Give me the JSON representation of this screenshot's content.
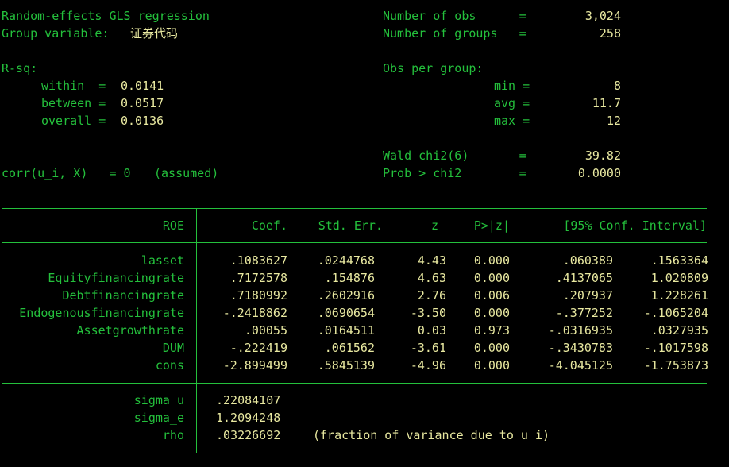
{
  "header": {
    "title": "Random-effects GLS regression",
    "group_label": "Group variable:",
    "group_value": "证券代码",
    "rsq_label": "R-sq:",
    "within_label": "within  =",
    "within_value": "0.0141",
    "between_label": "between =",
    "between_value": "0.0517",
    "overall_label": "overall =",
    "overall_value": "0.0136",
    "corr_label": "corr(u_i, X)   = 0",
    "corr_note": "(assumed)",
    "nobs_label": "Number of obs      =",
    "nobs_value": "3,024",
    "ngroups_label": "Number of groups   =",
    "ngroups_value": "258",
    "obs_per_group_label": "Obs per group:",
    "min_label": "min =",
    "min_value": "8",
    "avg_label": "avg =",
    "avg_value": "11.7",
    "max_label": "max =",
    "max_value": "12",
    "wald_label": "Wald chi2(6)       =",
    "wald_value": "39.82",
    "prob_label": "Prob > chi2        =",
    "prob_value": "0.0000"
  },
  "table": {
    "depvar": "ROE",
    "columns": [
      "Coef.",
      "Std. Err.",
      "z",
      "P>|z|",
      "[95% Conf. Interval]"
    ],
    "rows": [
      {
        "name": "lasset",
        "coef": ".1083627",
        "se": ".0244768",
        "z": "4.43",
        "p": "0.000",
        "lo": ".060389",
        "hi": ".1563364"
      },
      {
        "name": "Equityfinancingrate",
        "coef": ".7172578",
        "se": ".154876",
        "z": "4.63",
        "p": "0.000",
        "lo": ".4137065",
        "hi": "1.020809"
      },
      {
        "name": "Debtfinancingrate",
        "coef": ".7180992",
        "se": ".2602916",
        "z": "2.76",
        "p": "0.006",
        "lo": ".207937",
        "hi": "1.228261"
      },
      {
        "name": "Endogenousfinancingrate",
        "coef": "-.2418862",
        "se": ".0690654",
        "z": "-3.50",
        "p": "0.000",
        "lo": "-.377252",
        "hi": "-.1065204"
      },
      {
        "name": "Assetgrowthrate",
        "coef": ".00055",
        "se": ".0164511",
        "z": "0.03",
        "p": "0.973",
        "lo": "-.0316935",
        "hi": ".0327935"
      },
      {
        "name": "DUM",
        "coef": "-.222419",
        "se": ".061562",
        "z": "-3.61",
        "p": "0.000",
        "lo": "-.3430783",
        "hi": "-.1017598"
      },
      {
        "name": "_cons",
        "coef": "-2.899499",
        "se": ".5845139",
        "z": "-4.96",
        "p": "0.000",
        "lo": "-4.045125",
        "hi": "-1.753873"
      }
    ],
    "sigma_u_label": "sigma_u",
    "sigma_u": ".22084107",
    "sigma_e_label": "sigma_e",
    "sigma_e": "1.2094248",
    "rho_label": "rho",
    "rho": ".03226692",
    "rho_note": "(fraction of variance due to u_i)"
  }
}
